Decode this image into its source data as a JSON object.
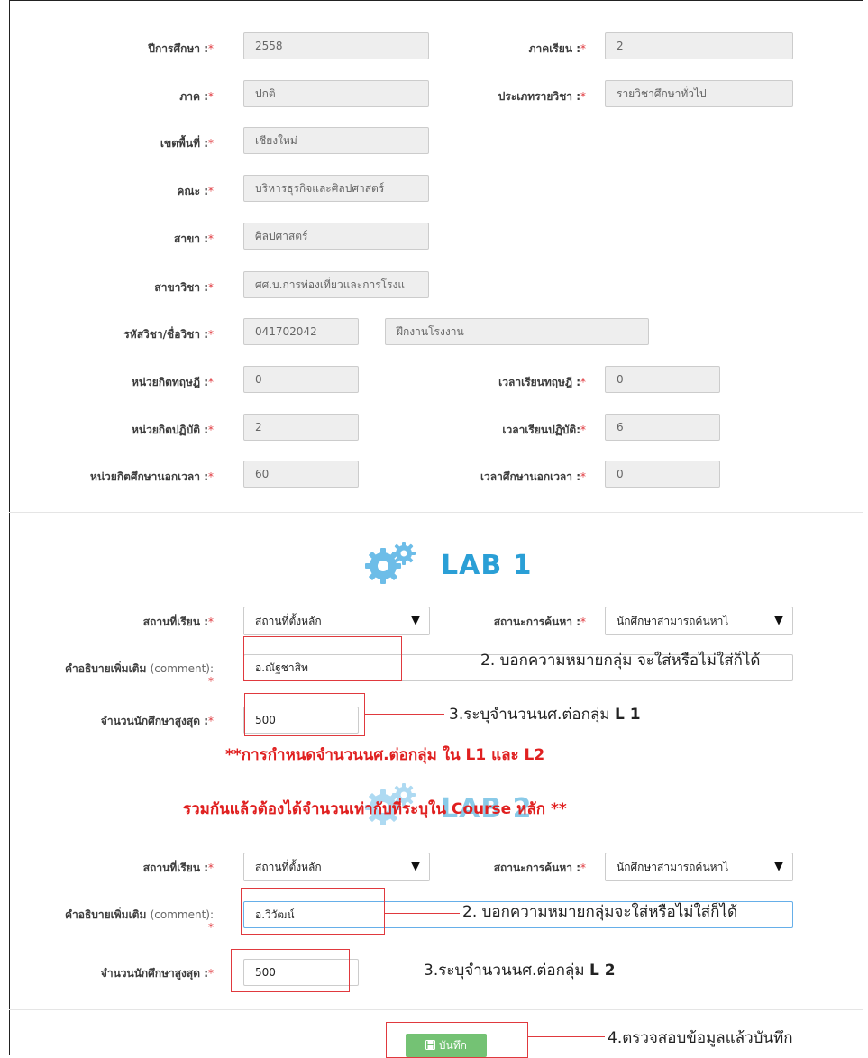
{
  "course_info": {
    "year": {
      "label": "ปีการศึกษา :",
      "value": "2558"
    },
    "semester": {
      "label": "ภาคเรียน :",
      "value": "2"
    },
    "term_type": {
      "label": "ภาค :",
      "value": "ปกติ"
    },
    "course_type": {
      "label": "ประเภทรายวิชา :",
      "value": "รายวิชาศึกษาทั่วไป"
    },
    "campus": {
      "label": "เขตพื้นที่ :",
      "value": "เชียงใหม่"
    },
    "faculty": {
      "label": "คณะ :",
      "value": "บริหารธุรกิจและศิลปศาสตร์"
    },
    "department": {
      "label": "สาขา :",
      "value": "ศิลปศาสตร์"
    },
    "program": {
      "label": "สาขาวิชา :",
      "value": "ศศ.บ.การท่องเที่ยวและการโรงแ"
    },
    "course": {
      "label": "รหัสวิชา/ชื่อวิชา :",
      "code": "041702042",
      "name": "ฝึกงานโรงงาน"
    },
    "theory_credits": {
      "label": "หน่วยกิตทฤษฎี :",
      "value": "0"
    },
    "theory_hours": {
      "label": "เวลาเรียนทฤษฎี :",
      "value": "0"
    },
    "practice_credits": {
      "label": "หน่วยกิตปฏิบัติ :",
      "value": "2"
    },
    "practice_hours": {
      "label": "เวลาเรียนปฏิบัติ:",
      "value": "6"
    },
    "self_study_credits": {
      "label": "หน่วยกิตศึกษานอกเวลา :",
      "value": "60"
    },
    "self_study_hours": {
      "label": "เวลาศึกษานอกเวลา :",
      "value": "0"
    }
  },
  "required_mark": "*",
  "lab1": {
    "title": "LAB 1",
    "location_label": "สถานที่เรียน :",
    "location_value": "สถานที่ตั้งหลัก",
    "search_label": "สถานะการค้นหา :",
    "search_value": "นักศึกษาสามารถค้นหาไ",
    "comment_label": "คำอธิบายเพิ่มเติม",
    "comment_label_en": "(comment):",
    "comment_value": "อ.ณัฐชาสิท",
    "max_label": "จำนวนนักศึกษาสูงสุด :",
    "max_value": "500"
  },
  "lab2": {
    "title": "LAB 2",
    "location_label": "สถานที่เรียน :",
    "location_value": "สถานที่ตั้งหลัก",
    "search_label": "สถานะการค้นหา :",
    "search_value": "นักศึกษาสามารถค้นหาไ",
    "comment_label": "คำอธิบายเพิ่มเติม",
    "comment_label_en": "(comment):",
    "comment_value": "อ.วิวัฒน์",
    "max_label": "จำนวนนักศึกษาสูงสุด :",
    "max_value": "500"
  },
  "save_button": "บันทึก",
  "select_arrow": "▼",
  "annotations": {
    "lab1_comment": "2. บอกความหมายกลุ่ม จะใส่หรือไม่ใส่ก็ได้",
    "lab1_max": "3.ระบุจำนวนนศ.ต่อกลุ่ม",
    "lab1_max_bold": "L 1",
    "red_line1": "**การกำหนดจำนวนนศ.ต่อกลุ่ม ใน L1 และ L2",
    "red_line2": "รวมกันแล้วต้องได้จำนวนเท่ากับที่ระบุใน Course หลัก **",
    "lab2_comment": "2. บอกความหมายกลุ่มจะใส่หรือไม่ใส่ก็ได้",
    "lab2_max": "3.ระบุจำนวนนศ.ต่อกลุ่ม",
    "lab2_max_bold": "L 2",
    "save": "4.ตรวจสอบข้อมูลแล้วบันทึก"
  },
  "colors": {
    "accent": "#2a9fd6",
    "annotation": "#e0393e",
    "save": "#5cb85c"
  }
}
